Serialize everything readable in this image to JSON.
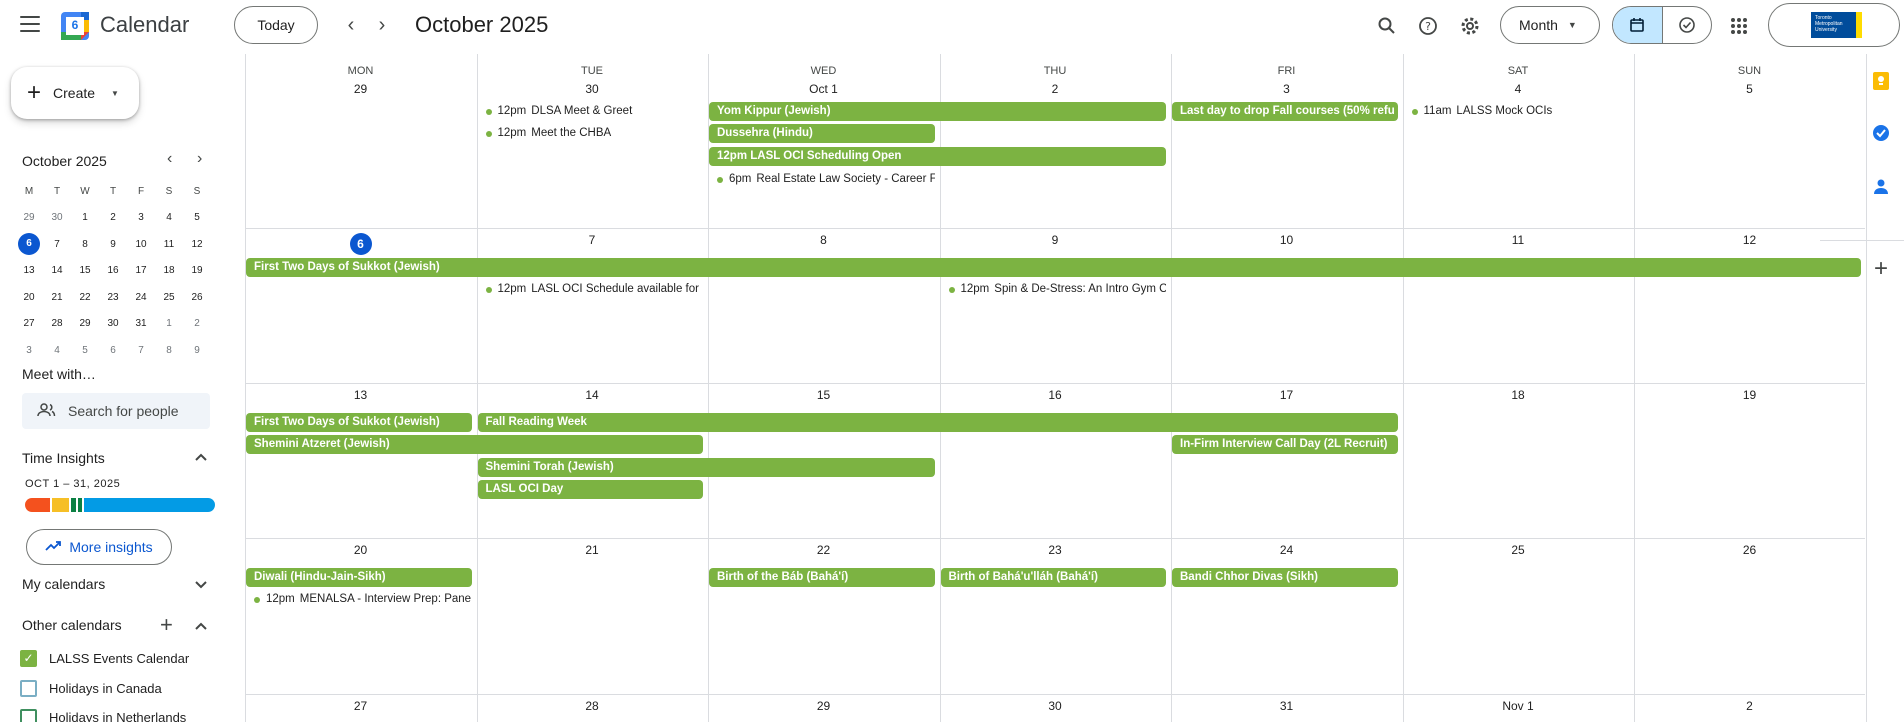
{
  "header": {
    "app_title": "Calendar",
    "logo_day": "6",
    "today_label": "Today",
    "month_title": "October 2025",
    "view_label": "Month",
    "account_logo_text": "Toronto Metropolitan University"
  },
  "sidebar": {
    "create_label": "Create",
    "mini_title": "October 2025",
    "mini_dow": [
      "M",
      "T",
      "W",
      "T",
      "F",
      "S",
      "S"
    ],
    "mini_weeks": [
      [
        "29",
        "30",
        "1",
        "2",
        "3",
        "4",
        "5"
      ],
      [
        "6",
        "7",
        "8",
        "9",
        "10",
        "11",
        "12"
      ],
      [
        "13",
        "14",
        "15",
        "16",
        "17",
        "18",
        "19"
      ],
      [
        "20",
        "21",
        "22",
        "23",
        "24",
        "25",
        "26"
      ],
      [
        "27",
        "28",
        "29",
        "30",
        "31",
        "1",
        "2"
      ],
      [
        "3",
        "4",
        "5",
        "6",
        "7",
        "8",
        "9"
      ]
    ],
    "meet_with": "Meet with…",
    "search_people_placeholder": "Search for people",
    "time_insights": "Time Insights",
    "insight_range": "OCT 1 – 31, 2025",
    "more_insights": "More insights",
    "my_calendars": "My calendars",
    "other_calendars": "Other calendars",
    "calendars": [
      {
        "label": "LALSS Events Calendar",
        "checked": true
      },
      {
        "label": "Holidays in Canada",
        "checked": false
      },
      {
        "label": "Holidays in Netherlands",
        "checked": false
      }
    ],
    "insight_colors": [
      "#f4511e",
      "#f6bf26",
      "#0b8043",
      "#039be5"
    ]
  },
  "calendar": {
    "dow": [
      "MON",
      "TUE",
      "WED",
      "THU",
      "FRI",
      "SAT",
      "SUN"
    ],
    "weeks": [
      [
        "29",
        "30",
        "Oct 1",
        "2",
        "3",
        "4",
        "5"
      ],
      [
        "6",
        "7",
        "8",
        "9",
        "10",
        "11",
        "12"
      ],
      [
        "13",
        "14",
        "15",
        "16",
        "17",
        "18",
        "19"
      ],
      [
        "20",
        "21",
        "22",
        "23",
        "24",
        "25",
        "26"
      ],
      [
        "27",
        "28",
        "29",
        "30",
        "31",
        "Nov 1",
        "2"
      ]
    ],
    "event_color": "#7cb342",
    "allday_events": {
      "yom_kippur": "Yom Kippur (Jewish)",
      "dussehra": "Dussehra (Hindu)",
      "lasl_oci_sched": "12pm LASL OCI Scheduling Open",
      "last_day_drop": "Last day to drop Fall courses (50% refu",
      "sukkot_w2": "First Two Days of Sukkot (Jewish)",
      "sukkot_w3": "First Two Days of Sukkot (Jewish)",
      "fall_reading": "Fall Reading Week",
      "shemini_atzeret": "Shemini Atzeret (Jewish)",
      "in_firm": "In-Firm Interview Call Day (2L Recruit)",
      "shemini_torah": "Shemini Torah (Jewish)",
      "lasl_oci_day": "LASL OCI Day",
      "diwali": "Diwali (Hindu-Jain-Sikh)",
      "bab": "Birth of the Báb (Bahá'í)",
      "bahaullah": "Birth of Bahá'u'lláh (Bahá'í)",
      "bandi": "Bandi Chhor Divas (Sikh)"
    },
    "timed_events": {
      "dlsa": {
        "time": "12pm",
        "title": "DLSA Meet & Greet"
      },
      "chba": {
        "time": "12pm",
        "title": "Meet the CHBA"
      },
      "real_estate": {
        "time": "6pm",
        "title": "Real Estate Law Society - Career F"
      },
      "lalss_mock": {
        "time": "11am",
        "title": "LALSS Mock OCIs"
      },
      "lasl_sched_avail": {
        "time": "12pm",
        "title": "LASL OCI Schedule available for"
      },
      "spin": {
        "time": "12pm",
        "title": "Spin & De-Stress: An Intro Gym C"
      },
      "menalsa": {
        "time": "12pm",
        "title": "MENALSA - Interview Prep: Pane"
      }
    }
  }
}
